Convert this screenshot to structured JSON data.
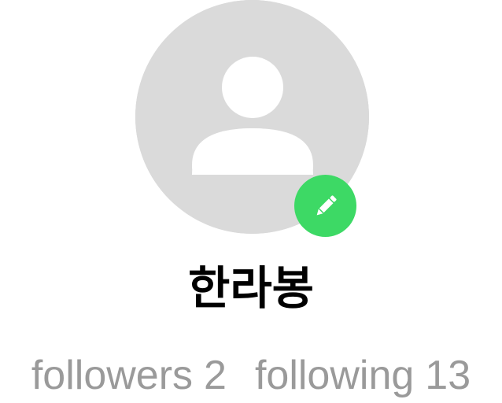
{
  "profile": {
    "name": "한라봉",
    "avatar_icon": "person-placeholder-icon",
    "avatar_bg": "#dadada",
    "avatar_fg": "#ffffff",
    "edit_icon": "pencil-icon",
    "edit_badge_color": "#3dd965"
  },
  "stats": {
    "followers_label": "followers",
    "followers_count": "2",
    "following_label": "following",
    "following_count": "13",
    "text_color": "#9a9a9a"
  }
}
